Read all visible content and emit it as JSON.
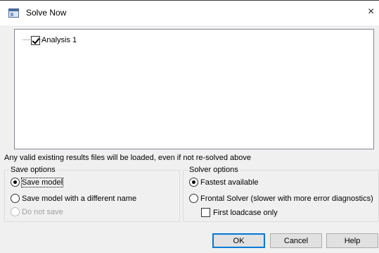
{
  "window": {
    "title": "Solve Now",
    "close_glyph": "×",
    "icon": "app-window-icon"
  },
  "tree": {
    "items": [
      {
        "label": "Analysis 1",
        "checked": true
      }
    ]
  },
  "info_text": "Any valid existing results files will be loaded, even if not re-solved above",
  "save_options": {
    "title": "Save options",
    "options": [
      {
        "label": "Save model",
        "selected": true,
        "disabled": false
      },
      {
        "label": "Save model with a different name",
        "selected": false,
        "disabled": false
      },
      {
        "label": "Do not save",
        "selected": false,
        "disabled": true
      }
    ]
  },
  "solver_options": {
    "title": "Solver options",
    "options": [
      {
        "label": "Fastest available",
        "selected": true
      },
      {
        "label": "Frontal Solver (slower with more error diagnostics)",
        "selected": false
      }
    ],
    "first_loadcase": {
      "label": "First loadcase only",
      "checked": false
    }
  },
  "buttons": {
    "ok": "OK",
    "cancel": "Cancel",
    "help": "Help"
  },
  "colors": {
    "dialog_bg": "#f0f0f0",
    "default_button_border": "#0078d7"
  }
}
